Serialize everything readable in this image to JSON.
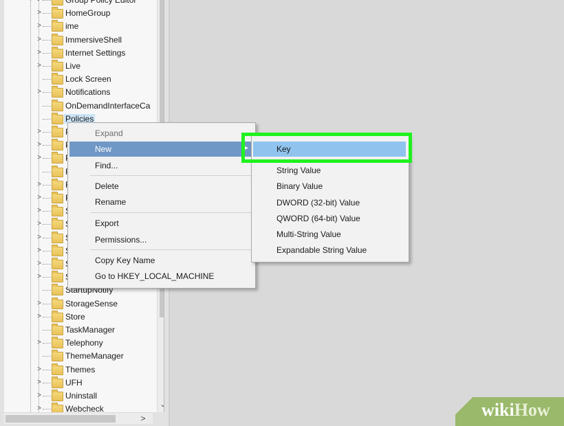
{
  "tree": {
    "rows": [
      {
        "label": "Group Policy Editor",
        "expander": ">"
      },
      {
        "label": "HomeGroup",
        "expander": ">"
      },
      {
        "label": "ime",
        "expander": ">"
      },
      {
        "label": "ImmersiveShell",
        "expander": ">"
      },
      {
        "label": "Internet Settings",
        "expander": ">"
      },
      {
        "label": "Live",
        "expander": ">"
      },
      {
        "label": "Lock Screen",
        "expander": ""
      },
      {
        "label": "Notifications",
        "expander": ">"
      },
      {
        "label": "OnDemandInterfaceCa",
        "expander": ""
      },
      {
        "label": "Policies",
        "expander": ""
      },
      {
        "label": "Pr",
        "expander": ">"
      },
      {
        "label": "Pr",
        "expander": ">"
      },
      {
        "label": "Pr",
        "expander": ">"
      },
      {
        "label": "R",
        "expander": ""
      },
      {
        "label": "R",
        "expander": ">"
      },
      {
        "label": "R",
        "expander": ">"
      },
      {
        "label": "Sc",
        "expander": ">"
      },
      {
        "label": "Se",
        "expander": ">"
      },
      {
        "label": "Se",
        "expander": ">"
      },
      {
        "label": "Se",
        "expander": ">"
      },
      {
        "label": "Sh",
        "expander": ">"
      },
      {
        "label": "Sh",
        "expander": ">"
      },
      {
        "label": "StartupNotify",
        "expander": ""
      },
      {
        "label": "StorageSense",
        "expander": ">"
      },
      {
        "label": "Store",
        "expander": ">"
      },
      {
        "label": "TaskManager",
        "expander": ""
      },
      {
        "label": "Telephony",
        "expander": ">"
      },
      {
        "label": "ThemeManager",
        "expander": ""
      },
      {
        "label": "Themes",
        "expander": ">"
      },
      {
        "label": "UFH",
        "expander": ">"
      },
      {
        "label": "Uninstall",
        "expander": ">"
      },
      {
        "label": "Webcheck",
        "expander": ">"
      }
    ],
    "selected_label": "Policies"
  },
  "scrollbars": {
    "down_arrow": "⌄",
    "right_arrow": ">"
  },
  "context_menu": {
    "expand": "Expand",
    "new": "New",
    "find": "Find...",
    "delete": "Delete",
    "rename": "Rename",
    "export": "Export",
    "permissions": "Permissions...",
    "copy_key_name": "Copy Key Name",
    "go_to": "Go to HKEY_LOCAL_MACHINE"
  },
  "new_submenu": {
    "key": "Key",
    "string_value": "String Value",
    "binary_value": "Binary Value",
    "dword_value": "DWORD (32-bit) Value",
    "qword_value": "QWORD (64-bit) Value",
    "multi_string_value": "Multi-String Value",
    "expandable_string_value": "Expandable String Value"
  },
  "watermark": {
    "wiki": "wiki",
    "how": "How"
  },
  "colors": {
    "menu_highlight": "#6f98c6",
    "submenu_highlight": "#90c4ef",
    "callout_green": "#1ff21f"
  }
}
